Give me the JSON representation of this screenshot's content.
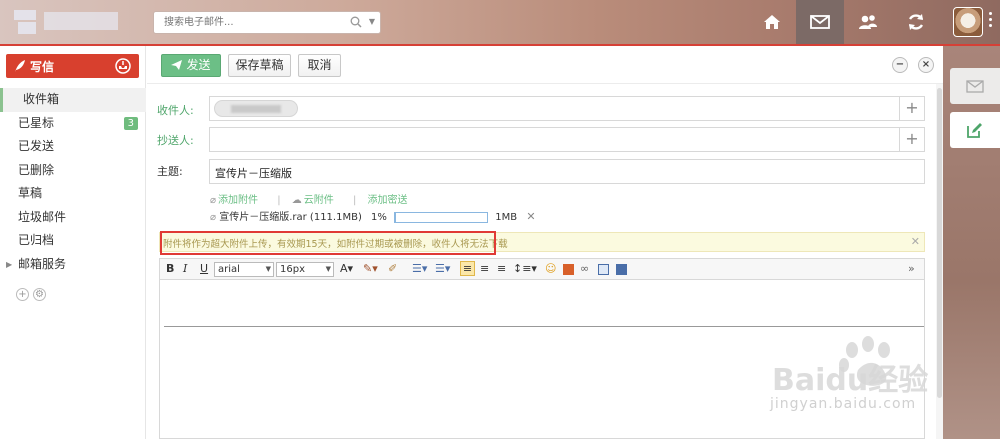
{
  "header": {
    "search_placeholder": "搜索电子邮件...",
    "nav": [
      "home-icon",
      "mail-icon",
      "contacts-icon",
      "sync-icon"
    ]
  },
  "sidebar": {
    "compose_label": "写信",
    "folders": [
      {
        "label": "收件箱"
      },
      {
        "label": "已星标",
        "badge": "3"
      },
      {
        "label": "已发送"
      },
      {
        "label": "已删除"
      },
      {
        "label": "草稿"
      },
      {
        "label": "垃圾邮件"
      },
      {
        "label": "已归档"
      },
      {
        "label": "邮箱服务"
      }
    ]
  },
  "toolbar": {
    "send_label": "发送",
    "save_label": "保存草稿",
    "cancel_label": "取消"
  },
  "form": {
    "to_label": "收件人:",
    "cc_label": "抄送人:",
    "subject_label": "主题:",
    "subject_value": "宣传片－压缩版",
    "add_attachment": "添加附件",
    "cloud_attachment": "云附件",
    "add_password": "添加密送"
  },
  "attachment": {
    "name": "宣传片－压缩版.rar (111.1MB)",
    "progress_text": "1%",
    "progress": 0.01,
    "size_label": "1MB"
  },
  "notice": {
    "text": "附件将作为超大附件上传，有效期15天，如附件过期或被删除，收件人将无法下载"
  },
  "editor": {
    "font": "arial",
    "size": "16px",
    "bold": "B",
    "italic": "I",
    "underline": "U"
  },
  "watermark": {
    "brand": "Baidu经验",
    "url": "jingyan.baidu.com"
  },
  "colors": {
    "accent_red": "#d8402e",
    "send_green": "#6cbf86",
    "notice_bg": "#fbfadf",
    "highlight": "#e03a35"
  }
}
